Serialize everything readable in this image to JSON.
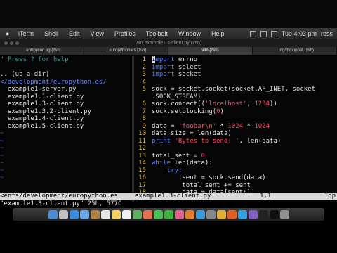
{
  "menubar": {
    "app_name": "iTerm",
    "items": [
      "Shell",
      "Edit",
      "View",
      "Profiles",
      "Toolbelt",
      "Window",
      "Help"
    ],
    "clock": "Tue 4:03 pm",
    "user": "ross"
  },
  "window": {
    "title": "vim example1.3-client.py (zsh)"
  },
  "tabs": [
    {
      "label": "...ent/pycon.eg (zsh)",
      "active": false
    },
    {
      "label": "...europython.es (zsh)",
      "active": false
    },
    {
      "label": "vim (zsh)",
      "active": true
    },
    {
      "label": "...ing/fb/puppet (zsh)",
      "active": false
    }
  ],
  "left_pane": {
    "help_line": "\" Press ? for help",
    "up_dir": ".. (up a dir)",
    "current_dir": "</development/europython.es/",
    "files": [
      "example1-server.py",
      "example1.1-client.py",
      "example1.3-client.py",
      "example1.3.2-client.py",
      "example1.4-client.py",
      "example1.5-client.py"
    ]
  },
  "code_lines": [
    {
      "n": "1",
      "kw": "import",
      "rest": " errno"
    },
    {
      "n": "2",
      "kw": "import",
      "rest": " select"
    },
    {
      "n": "3",
      "kw": "import",
      "rest": " socket"
    },
    {
      "n": "4",
      "kw": "",
      "rest": ""
    },
    {
      "n": "5",
      "kw": "",
      "rest": "sock = socket.socket(socket.AF_INET, socket"
    },
    {
      "n": "",
      "kw": "",
      "rest": ".SOCK_STREAM)"
    },
    {
      "n": "6",
      "kw": "",
      "rest": "sock.connect(('localhost', 1234))"
    },
    {
      "n": "7",
      "kw": "",
      "rest": "sock.setblocking(0)"
    },
    {
      "n": "8",
      "kw": "",
      "rest": ""
    },
    {
      "n": "9",
      "kw": "",
      "rest": "data = 'foobar\\n' * 1024 * 1024"
    },
    {
      "n": "10",
      "kw": "",
      "rest": "data_size = len(data)"
    },
    {
      "n": "11",
      "kw": "print",
      "rest": " 'Bytes to send: ', len(data)"
    },
    {
      "n": "12",
      "kw": "",
      "rest": ""
    },
    {
      "n": "13",
      "kw": "",
      "rest": "total_sent = 0"
    },
    {
      "n": "14",
      "kw": "while",
      "rest": " len(data):"
    },
    {
      "n": "15",
      "kw": "    try:",
      "rest": ""
    },
    {
      "n": "16",
      "kw": "",
      "rest": "        sent = sock.send(data)"
    },
    {
      "n": "17",
      "kw": "",
      "rest": "        total_sent += sent"
    },
    {
      "n": "18",
      "kw": "",
      "rest": "        data = data[sent:]"
    }
  ],
  "statusbar": {
    "left": "<ents/development/europython.es",
    "right_file": "example1.3-client.py",
    "position": "1,1",
    "scroll": "Top"
  },
  "cmdline": "\"example1.3-client.py\" 25L, 577C",
  "dock": {
    "icons": [
      "finder-icon",
      "launchpad-icon",
      "safari-icon",
      "mail-icon",
      "contacts-icon",
      "calendar-icon",
      "notes-icon",
      "reminders-icon",
      "maps-icon",
      "photos-icon",
      "messages-icon",
      "facetime-icon",
      "itunes-icon",
      "ibooks-icon",
      "appstore-icon",
      "preferences-icon",
      "chrome-icon",
      "firefox-icon",
      "skype-icon",
      "slack-icon",
      "terminal-icon",
      "iterm-icon",
      "trash-icon"
    ],
    "colors": [
      "#4a8cd8",
      "#c0c0c0",
      "#3a8be0",
      "#6aa6e8",
      "#b08040",
      "#e8e8e8",
      "#f0d060",
      "#f0f0f0",
      "#60b060",
      "#e07050",
      "#4ac050",
      "#40b040",
      "#e06090",
      "#e08030",
      "#3a9ae0",
      "#888888",
      "#e0b030",
      "#e06020",
      "#30a0e0",
      "#8060c0",
      "#222222",
      "#101010",
      "#909090"
    ]
  },
  "accent": "#5b82ff"
}
